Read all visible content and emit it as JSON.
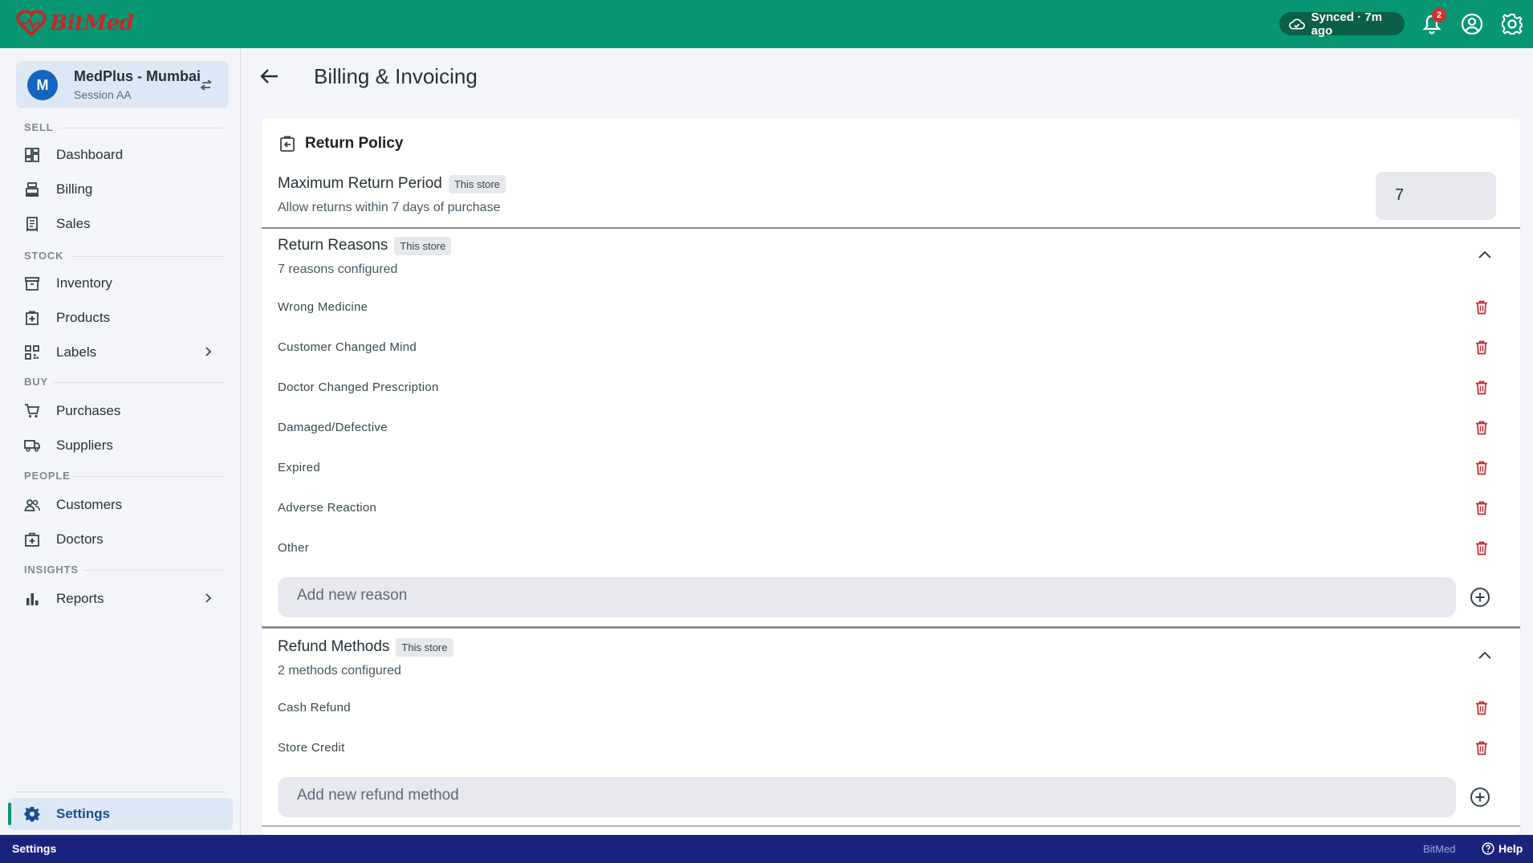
{
  "app": {
    "brand": "BitMed",
    "sync_status": "Synced · 7m ago",
    "notification_count": "2",
    "accent_color": "#079673"
  },
  "sidebar": {
    "store": {
      "avatar_letter": "M",
      "name": "MedPlus - Mumbai",
      "session": "Session AA"
    },
    "sections": {
      "sell": "SELL",
      "stock": "STOCK",
      "buy": "BUY",
      "people": "PEOPLE",
      "insights": "INSIGHTS"
    },
    "items": {
      "dashboard": "Dashboard",
      "billing": "Billing",
      "sales": "Sales",
      "inventory": "Inventory",
      "products": "Products",
      "labels": "Labels",
      "purchases": "Purchases",
      "suppliers": "Suppliers",
      "customers": "Customers",
      "doctors": "Doctors",
      "reports": "Reports",
      "settings": "Settings"
    }
  },
  "header": {
    "title": "Billing & Invoicing"
  },
  "return_policy": {
    "title": "Return Policy",
    "max_period": {
      "label": "Maximum Return Period",
      "chip": "This store",
      "description": "Allow returns within 7 days of purchase",
      "value": "7"
    },
    "reasons": {
      "label": "Return Reasons",
      "chip": "This store",
      "summary": "7 reasons configured",
      "items": [
        "Wrong Medicine",
        "Customer Changed Mind",
        "Doctor Changed Prescription",
        "Damaged/Defective",
        "Expired",
        "Adverse Reaction",
        "Other"
      ],
      "add_placeholder": "Add new reason"
    },
    "refund_methods": {
      "label": "Refund Methods",
      "chip": "This store",
      "summary": "2 methods configured",
      "items": [
        "Cash Refund",
        "Store Credit"
      ],
      "add_placeholder": "Add new refund method"
    }
  },
  "footer": {
    "context": "Settings",
    "brand": "BitMed",
    "help": "Help"
  }
}
